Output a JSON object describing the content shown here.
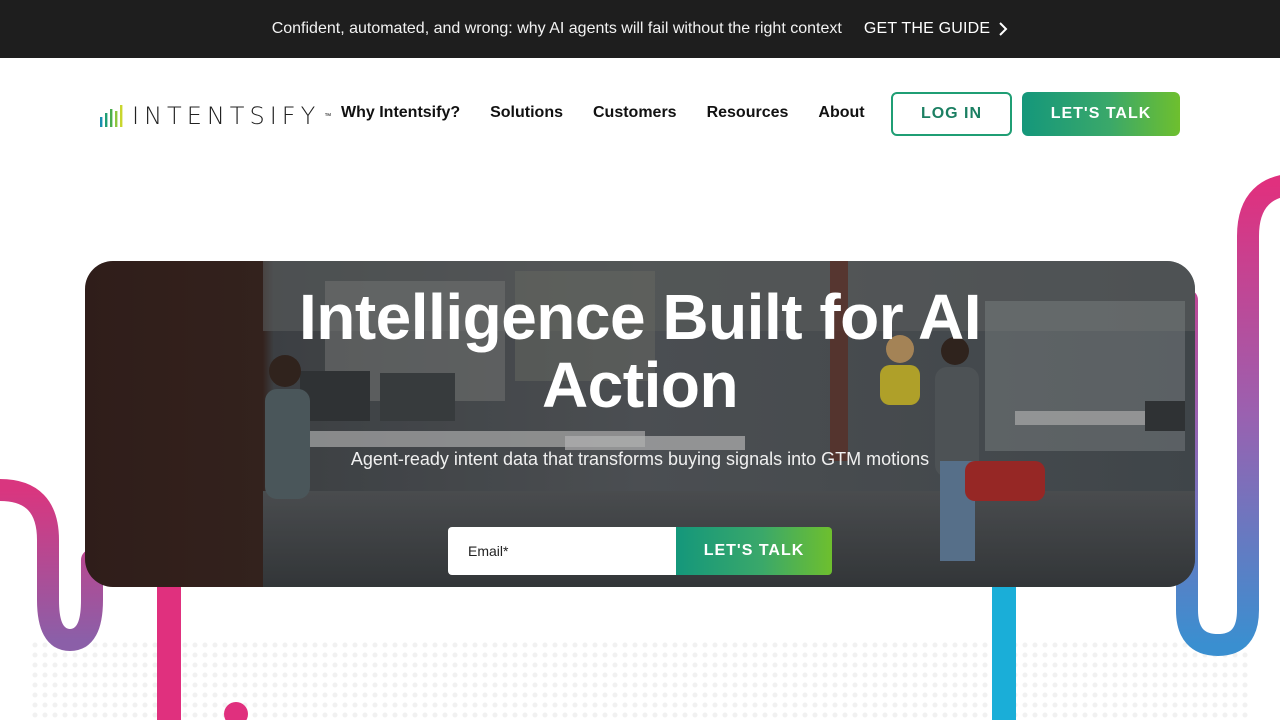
{
  "announcement": {
    "message": "Confident, automated, and wrong: why AI agents will fail without the right context",
    "cta_label": "GET THE GUIDE",
    "cta_icon": "chevron-right-icon"
  },
  "header": {
    "logo_text": "INTENTSIFY",
    "logo_tm": "™",
    "nav": [
      {
        "label": "Why Intentsify?"
      },
      {
        "label": "Solutions"
      },
      {
        "label": "Customers"
      },
      {
        "label": "Resources"
      },
      {
        "label": "About"
      }
    ],
    "login_label": "LOG IN",
    "talk_label": "LET'S TALK"
  },
  "hero": {
    "title_line1": "Intelligence Built for AI",
    "title_line2": "Action",
    "subtitle": "Agent-ready intent data that transforms buying signals into GTM motions",
    "email_placeholder": "Email*",
    "submit_label": "LET'S TALK"
  },
  "colors": {
    "announce_bg": "#1e1e1e",
    "brand_green": "#1f9e74",
    "gradient_start": "#14977b",
    "gradient_end": "#6ebf2e",
    "magenta": "#e0307e",
    "cyan": "#1aaed8"
  }
}
